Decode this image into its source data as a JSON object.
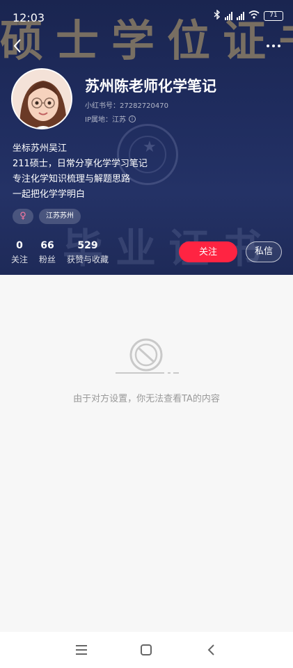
{
  "status_bar": {
    "time": "12:03",
    "network_label": "HD",
    "battery": "71"
  },
  "background": {
    "top_text": "硕士学位证书",
    "bottom_text": "毕业证书"
  },
  "profile": {
    "name": "苏州陈老师化学笔记",
    "id_line": "小红书号：27282720470",
    "ip_line": "IP属地：江苏",
    "bio": [
      "坐标苏州吴江",
      "211硕士，日常分享化学学习笔记",
      "专注化学知识梳理与解题思路",
      "一起把化学学明白"
    ],
    "gender_symbol": "♀",
    "location_tag": "江苏苏州"
  },
  "stats": [
    {
      "num": "0",
      "label": "关注"
    },
    {
      "num": "66",
      "label": "粉丝"
    },
    {
      "num": "529",
      "label": "获赞与收藏"
    }
  ],
  "actions": {
    "follow": "关注",
    "message": "私信"
  },
  "empty_state": {
    "text": "由于对方设置，你无法查看TA的内容"
  },
  "colors": {
    "accent": "#ff2442",
    "header_bg": "#1f2c5e"
  }
}
